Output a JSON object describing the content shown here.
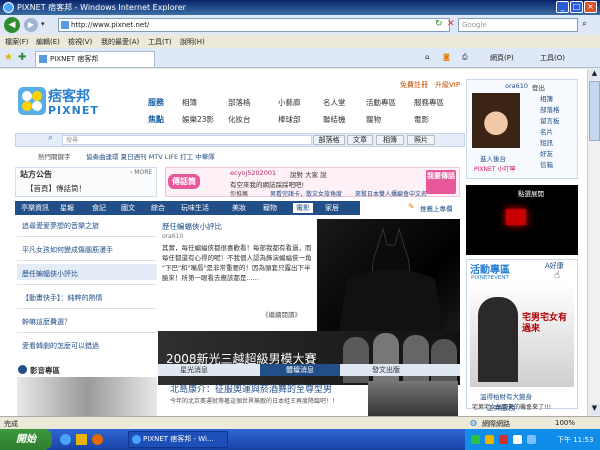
{
  "window": {
    "title": "PIXNET 痞客邦 - Windows Internet Explorer"
  },
  "address": {
    "url": "http://www.pixnet.net/",
    "search_placeholder": "Google"
  },
  "menu": [
    "檔案(F)",
    "編輯(E)",
    "檢視(V)",
    "我的最愛(A)",
    "工具(T)",
    "說明(H)"
  ],
  "tab": {
    "label": "PIXNET 痞客邦"
  },
  "toolbar": {
    "page": "網頁(P)",
    "tools": "工具(O)"
  },
  "header": {
    "logo_cn": "痞客邦",
    "logo_en": "PIXNET",
    "register": "免費註冊",
    "upgrade": "升級VIP",
    "service_label": "服務",
    "services": [
      "相簿",
      "部落格",
      "小藝廊",
      "名人堂",
      "活動專區",
      "服務專區"
    ],
    "focus_label": "焦點",
    "focus": [
      "娛樂23影",
      "化妝台",
      "棒球部",
      "聯結機",
      "寵物",
      "電影"
    ],
    "search_placeholder": "搜尋",
    "search_tabs": [
      "部落格",
      "文章",
      "相簿",
      "照片"
    ],
    "hot_label": "熱門關鍵字",
    "hot_text": "協奏曲連環 夏日週刊 MTV LIFE 打工 中華隊"
  },
  "notice": {
    "title": "站方公告",
    "more": "› MORE",
    "text": "【首頁】傳話筒！"
  },
  "talk": {
    "badge": "傳話筒",
    "user": "ecyoj5202001",
    "said": "說對 大家 說",
    "msg": "有空來我的網誌踩踩吧吧!",
    "button": "我要傳話",
    "recommend": "你推薦",
    "recommend_text": "男看完諸卡，散文女旅角度",
    "recommend_text2": "來幫日本雙人攝編會中文名"
  },
  "categories": [
    "亭樂資訊",
    "星報",
    "食記",
    "國文",
    "綜合",
    "玩味生活",
    "美妝",
    "寵物",
    "電影",
    "家居"
  ],
  "category_right": "推薦上專欄",
  "left_links": [
    "追尋愛爱夢想的音樂之旅",
    "平凡女孩如何變成傷腦筋漫手",
    "歷任蝙蝠俠小評比",
    "【動畫快手】：純粹的熱情",
    "幹嘛這麼費選？",
    "愛看韓劇的怎麼可以錯過"
  ],
  "article": {
    "title": "歷任蝙蝠俠小評比",
    "author": "ora610",
    "body": "其實，每任蝙蝠俠都很喜歡看！每部我都有看過，而每任都還有心得的呢！不我個人認為飾演蝙蝠俠一角 \"下巴\"和\"嘴唇\"是非常重要的！因為頭套只露出下半臉來！所第一眼看去應該都是......",
    "more": "《繼續閱讀》"
  },
  "banner": {
    "text": "2008新光三越超級男模大賽"
  },
  "bottom_tabs": [
    "星光消息",
    "體壇消息",
    "發文出版"
  ],
  "headline": {
    "title": "北島康介：征服奧運與菸酒舞的至尊型男",
    "text": "今年的北京奧運就等著這個世界無敵的日本蛙王再度降臨吧！！"
  },
  "shadow_label": "影音專區",
  "user_panel": {
    "name": "ora610",
    "logout": "登出",
    "links": [
      "相簿",
      "部落格",
      "留言板",
      "名片",
      "短訊",
      "好友",
      "信箱"
    ],
    "enter": "進入後台",
    "tip": "PIXNET 小叮嚀"
  },
  "ad_top": {
    "label": "點選展開"
  },
  "event": {
    "title": "活動專區",
    "subtitle": "PIXNETEVENT",
    "more": "A好康",
    "ad_text": "宅男宅女有過來",
    "caption": "溫得柏財有大變身",
    "desc": "宅男宅女出頭天的機會來了!!!"
  },
  "biz": {
    "label": "工商服務"
  },
  "status": {
    "left": "完成",
    "zone": "網際網路",
    "zoom": "100%"
  },
  "taskbar": {
    "start": "開始",
    "item": "PIXNET 痞客邦 - Wi...",
    "time": "下午 11:53"
  }
}
